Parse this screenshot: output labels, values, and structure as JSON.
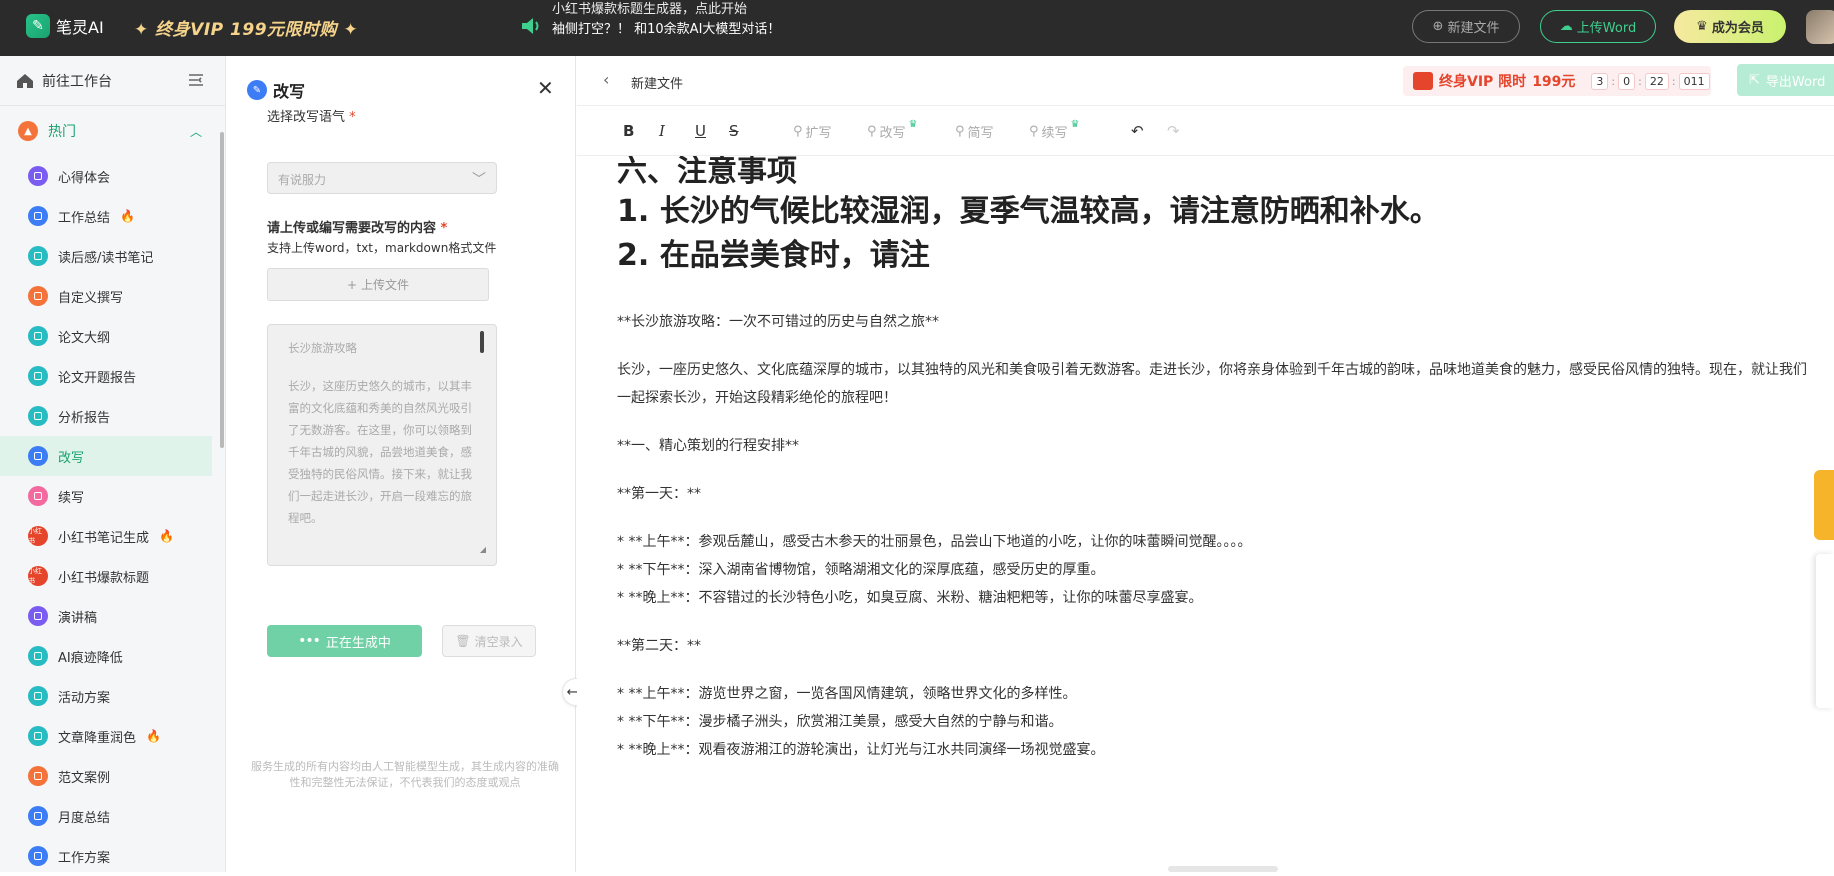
{
  "topbar": {
    "logo_text": "笔灵AI",
    "vip_banner": "终身VIP 199元限时购",
    "announce_line1": "小红书爆款标题生成器，点此开始",
    "announce_line2": "袖侧打空？！ 和10余款AI大模型对话！",
    "new_file": "新建文件",
    "upload_word": "上传Word",
    "become_member": "成为会员"
  },
  "sidebar": {
    "workspace": "前往工作台",
    "category": "热门",
    "items": [
      {
        "label": "心得体会",
        "icon": "purple",
        "flame": false
      },
      {
        "label": "工作总结",
        "icon": "blue",
        "flame": true
      },
      {
        "label": "读后感/读书笔记",
        "icon": "teal",
        "flame": false
      },
      {
        "label": "自定义撰写",
        "icon": "orange",
        "flame": false
      },
      {
        "label": "论文大纲",
        "icon": "teal",
        "flame": false
      },
      {
        "label": "论文开题报告",
        "icon": "teal",
        "flame": false
      },
      {
        "label": "分析报告",
        "icon": "teal",
        "flame": false
      },
      {
        "label": "改写",
        "icon": "blue",
        "flame": false,
        "active": true
      },
      {
        "label": "续写",
        "icon": "pink",
        "flame": false
      },
      {
        "label": "小红书笔记生成",
        "icon": "red",
        "flame": true
      },
      {
        "label": "小红书爆款标题",
        "icon": "red",
        "flame": false
      },
      {
        "label": "演讲稿",
        "icon": "purple",
        "flame": false
      },
      {
        "label": "AI痕迹降低",
        "icon": "teal",
        "flame": false
      },
      {
        "label": "活动方案",
        "icon": "teal",
        "flame": false
      },
      {
        "label": "文章降重润色",
        "icon": "teal",
        "flame": true
      },
      {
        "label": "范文案例",
        "icon": "orange",
        "flame": false
      },
      {
        "label": "月度总结",
        "icon": "blue",
        "flame": false
      },
      {
        "label": "工作方案",
        "icon": "blue",
        "flame": false
      }
    ],
    "flame_glyph": "🔥",
    "red_icon_text": "小红书"
  },
  "panel": {
    "title": "改写",
    "tone_label": "选择改写语气",
    "tone_value": "有说服力",
    "content_label": "请上传或编写需要改写的内容",
    "content_hint": "支持上传word，txt，markdown格式文件",
    "upload_file": "上传文件",
    "input_title": "长沙旅游攻略",
    "input_body": "长沙，这座历史悠久的城市，以其丰富的文化底蕴和秀美的自然风光吸引了无数游客。在这里，你可以领略到千年古城的风貌，品尝地道美食，感受独特的民俗风情。接下来，就让我们一起走进长沙，开启一段难忘的旅程吧。",
    "generating": "正在生成中",
    "clear": "清空录入",
    "disclaimer": "服务生成的所有内容均由人工智能模型生成，其生成内容的准确性和完整性无法保证，不代表我们的态度或观点"
  },
  "editor": {
    "file_title": "新建文件",
    "promo_text": "终身VIP 限时",
    "promo_price": "199元",
    "timer": [
      "3",
      "0",
      "22",
      "011"
    ],
    "export": "导出Word",
    "tools": {
      "bold": "B",
      "italic": "I",
      "underline": "U",
      "strike": "S",
      "expand": "扩写",
      "rewrite": "改写",
      "shorten": "简写",
      "continue": "续写"
    },
    "heading_section": "六、注意事项",
    "heading_1": "1. 长沙的气候比较湿润，夏季气温较高，请注意防晒和补水。",
    "heading_2": "2. 在品尝美食时，请注",
    "paragraphs": [
      "**长沙旅游攻略：一次不可错过的历史与自然之旅**",
      "长沙，一座历史悠久、文化底蕴深厚的城市，以其独特的风光和美食吸引着无数游客。走进长沙，你将亲身体验到千年古城的韵味，品味地道美食的魅力，感受民俗风情的独特。现在，就让我们一起探索长沙，开始这段精彩绝伦的旅程吧！",
      "**一、精心策划的行程安排**",
      "**第一天：**",
      "* **上午**：参观岳麓山，感受古木参天的壮丽景色，品尝山下地道的小吃，让你的味蕾瞬间觉醒。。。。",
      "* **下午**：深入湖南省博物馆，领略湖湘文化的深厚底蕴，感受历史的厚重。",
      "* **晚上**：不容错过的长沙特色小吃，如臭豆腐、米粉、糖油粑粑等，让你的味蕾尽享盛宴。",
      "**第二天：**",
      "* **上午**：游览世界之窗，一览各国风情建筑，领略世界文化的多样性。",
      "* **下午**：漫步橘子洲头，欣赏湘江美景，感受大自然的宁静与和谐。",
      "* **晚上**：观看夜游湘江的游轮演出，让灯光与江水共同演绎一场视觉盛宴。"
    ]
  },
  "colors": {
    "brand": "#1aa36f",
    "accent_gold": "#f5d38a",
    "promo_red": "#e4452b"
  }
}
